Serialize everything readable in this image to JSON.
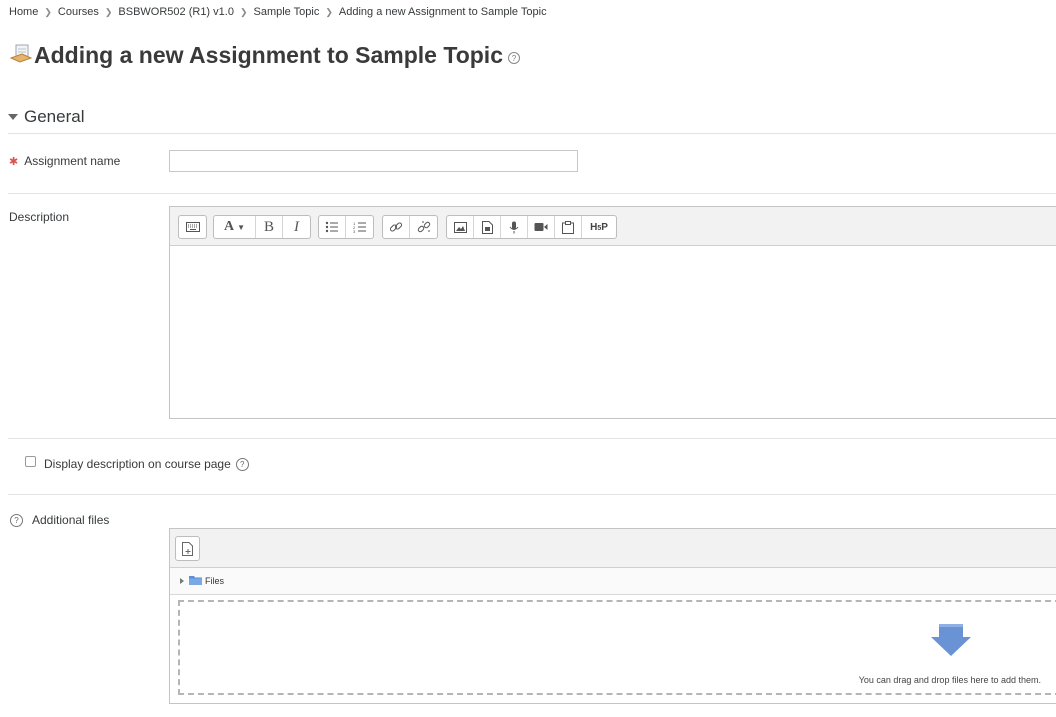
{
  "breadcrumb": [
    "Home",
    "Courses",
    "BSBWOR502 (R1) v1.0",
    "Sample Topic",
    "Adding a new Assignment to Sample Topic"
  ],
  "page": {
    "title": "Adding a new Assignment to Sample Topic"
  },
  "section": {
    "title": "General",
    "expanded": true
  },
  "fields": {
    "assignment_name": {
      "label": "Assignment name",
      "value": "",
      "required": true
    },
    "description": {
      "label": "Description",
      "value": ""
    },
    "display_description": {
      "label": "Display description on course page",
      "checked": false
    },
    "additional_files": {
      "label": "Additional files"
    }
  },
  "editor_toolbar": [
    [
      "keyboard-icon"
    ],
    [
      "font-icon",
      "bold-icon",
      "italic-icon"
    ],
    [
      "unordered-list-icon",
      "ordered-list-icon"
    ],
    [
      "link-icon",
      "unlink-icon"
    ],
    [
      "image-icon",
      "media-icon",
      "microphone-icon",
      "video-icon",
      "manage-files-icon",
      "h5p-icon"
    ]
  ],
  "filemanager": {
    "folder_label": "Files",
    "drop_hint": "You can drag and drop files here to add them."
  },
  "colors": {
    "required": "#d9534f",
    "folder": "#5b8fd3",
    "drop_arrow": "#6a93d6"
  }
}
